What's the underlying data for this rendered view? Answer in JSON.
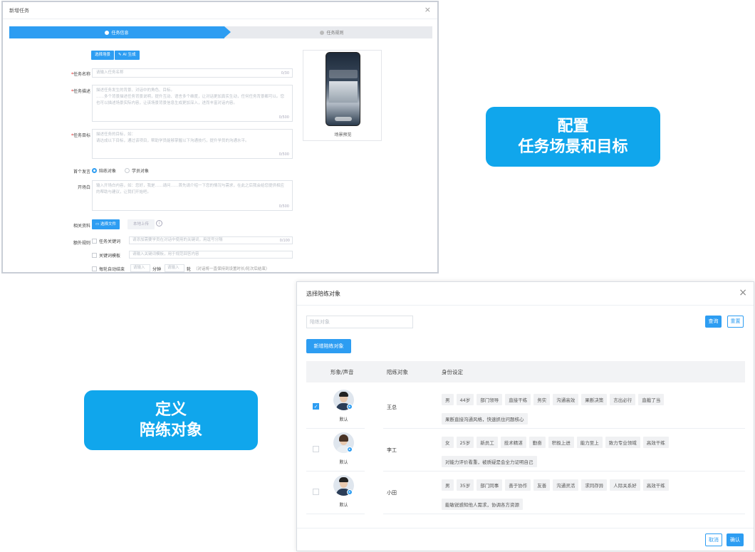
{
  "form_modal": {
    "title": "新增任务",
    "close": "×",
    "steps": [
      "任务信息",
      "任务规则"
    ],
    "top_buttons": [
      "选择场景",
      "AI 生成"
    ],
    "fields": {
      "task_name": {
        "label": "任务名称",
        "placeholder": "请输入任务名称",
        "count": "0/30"
      },
      "task_desc": {
        "label": "任务描述",
        "placeholder": "描述任务发生的背景、对话中的角色、目标。\n……多个背景描述任务背景说明，提升互动、语言多个维度，让对话更加真实生动，任何任务背景都可以。您也可以描述场景实际内容，让该场景背景信息生成更加深入，进而丰富对话内容。",
        "count": "0/500"
      },
      "task_goal": {
        "label": "任务目标",
        "placeholder": "描述任务的目标，如：\n请达成以下目标，通过该项目，帮助学员能够掌握以下沟通技巧，提升学员的沟通水平。",
        "count": "0/500"
      },
      "opening": {
        "label": "首个发言",
        "options": [
          "陪练对象",
          "学员对象"
        ],
        "selected": 0
      },
      "opening_line": {
        "label": "开场白",
        "placeholder": "输入开场白内容，如：您好，我是……请问……首先请介绍一下您的情况与需求，在此之后我会给您提供相应的帮助与建议，让我们开始吧。",
        "count": "0/500"
      },
      "attachment": {
        "label": "相关资料",
        "buttons": [
          "选择文件",
          "本地上传"
        ]
      },
      "extra": {
        "label": "额外规则",
        "items": [
          {
            "label": "任务关键词",
            "placeholder": "请添加需要学员在对话中使用的关键词，用逗号分隔",
            "count": "0/100"
          },
          {
            "label": "关键词模板",
            "placeholder": "请输入关键词模板，用于规范回答内容",
            "count": ""
          },
          {
            "label": "每轮自动结束",
            "inputs": [
              "请输入",
              "请输入"
            ],
            "units": [
              "分钟",
              "轮"
            ],
            "hint": "（对话将一直保持到设置时长/轮次后结束）"
          }
        ]
      }
    },
    "preview": {
      "caption": "场景预览"
    }
  },
  "callouts": {
    "config": [
      "配置",
      "任务场景和目标"
    ],
    "define": [
      "定义",
      "陪练对象"
    ]
  },
  "select_modal": {
    "title": "选择陪练对象",
    "close": "×",
    "search_placeholder": "陪练对象",
    "query_btn": "查询",
    "reset_btn": "重置",
    "add_btn": "新增陪练对象",
    "columns": [
      "形象/声音",
      "陪练对象",
      "身份设定"
    ],
    "rows": [
      {
        "checked": true,
        "voice": "默认",
        "name": "王总",
        "gender": "male",
        "tags": [
          "男",
          "44岁",
          "部门领导",
          "直接干练",
          "务实",
          "沟通高效",
          "果断决策",
          "言出必行",
          "直截了当",
          "果断直接沟通风格，快速抓住问题核心"
        ]
      },
      {
        "checked": false,
        "voice": "默认",
        "name": "李工",
        "gender": "female",
        "tags": [
          "女",
          "25岁",
          "新员工",
          "技术精湛",
          "勤奋",
          "积极上进",
          "能力至上",
          "致力专业领域",
          "高效干练",
          "对能力评价看重，被质疑是会全力证明自己"
        ]
      },
      {
        "checked": false,
        "voice": "默认",
        "name": "小田",
        "gender": "male",
        "tags": [
          "男",
          "35岁",
          "部门同事",
          "善于协作",
          "友善",
          "沟通灵活",
          "求同存异",
          "人际关系好",
          "高效干练",
          "能敏锐感知他人需求，协调各方资源"
        ]
      }
    ],
    "footer": {
      "cancel": "取消",
      "confirm": "确认"
    }
  },
  "colors": {
    "accent": "#2d9df2",
    "callout": "#10a6ec"
  }
}
